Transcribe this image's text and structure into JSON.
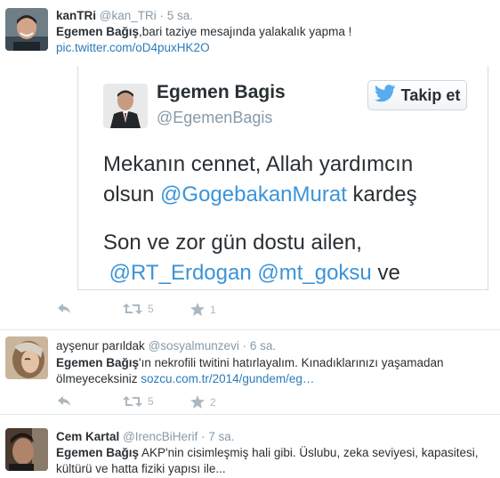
{
  "tweets": [
    {
      "fullname": "kanTRi",
      "handle": "@kan_TRi",
      "time": "5 sa.",
      "body_bold": "Egemen Bağış",
      "body_text": ",bari taziye mesajında yalakalık yapma !",
      "link": "pic.twitter.com/oD4puxHK2O",
      "retweets": "5",
      "favorites": "1"
    },
    {
      "fullname": "ayşenur parıldak",
      "handle": "@sosyalmunzevi",
      "time": "6 sa.",
      "body_bold": "Egemen Bağış",
      "body_text": "'ın nekrofili twitini hatırlayalım. Kınadıklarınızı yaşamadan ölmeyeceksiniz ",
      "link": "sozcu.com.tr/2014/gundem/eg…",
      "retweets": "5",
      "favorites": "2"
    },
    {
      "fullname": "Cem Kartal",
      "handle": "@IrencBiHerif",
      "time": "7 sa.",
      "body_bold": "Egemen Bağış",
      "body_text": " AKP'nin cisimleşmiş hali gibi. Üslubu, zeka seviyesi, kapasitesi, kültürü ve hatta fiziki yapısı ile..."
    }
  ],
  "embedded": {
    "name": "Egemen Bagis",
    "handle": "@EgemenBagis",
    "follow_label": "Takip et",
    "line1": "Mekanın cennet, Allah yardımcın",
    "line2_pre": "olsun ",
    "line2_mention": "@GogebakanMurat",
    "line2_post": " kardeş",
    "line3": "Son ve zor gün dostu ailen,",
    "line4_mention1": "@RT_Erdogan",
    "line4_mention2": "@mt_goksu",
    "line4_post": " ve"
  },
  "meta_separator": " · ",
  "colors": {
    "link": "#2b7bb9",
    "mention": "#3b94d9",
    "meta": "#8899a6",
    "action": "#aab8c2",
    "twitter_bird": "#55acee"
  },
  "icons": [
    "reply-icon",
    "retweet-icon",
    "favorite-star-icon",
    "twitter-bird-icon"
  ]
}
